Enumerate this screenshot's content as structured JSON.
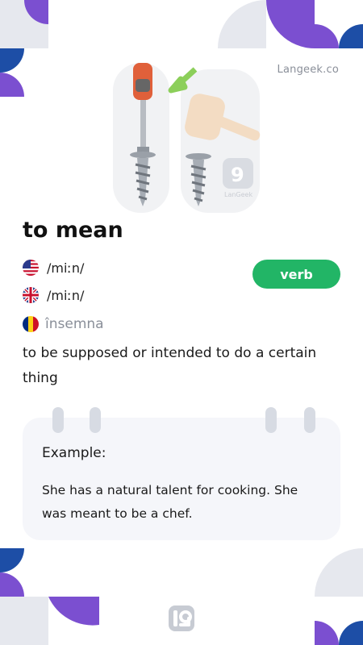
{
  "brand": {
    "name": "Langeek.co"
  },
  "illustration": {
    "description_icon": "screwdriver-hammer-screw-icon"
  },
  "entry": {
    "word": "to mean",
    "part_of_speech": "verb",
    "pronunciations": [
      {
        "region": "US",
        "flag_icon": "us-flag-icon",
        "ipa": "/miːn/"
      },
      {
        "region": "UK",
        "flag_icon": "uk-flag-icon",
        "ipa": "/miːn/"
      }
    ],
    "translation": {
      "language": "Romanian",
      "flag_icon": "romania-flag-icon",
      "text": "însemna"
    },
    "definition": "to be supposed or intended to do a certain thing"
  },
  "example": {
    "label": "Example:",
    "text": "She has a natural talent for cooking. She was meant to be a chef."
  },
  "colors": {
    "accent_green": "#22b566",
    "purple": "#7b4fd0",
    "blue": "#1d4ea6",
    "grey": "#e6e8ee"
  }
}
